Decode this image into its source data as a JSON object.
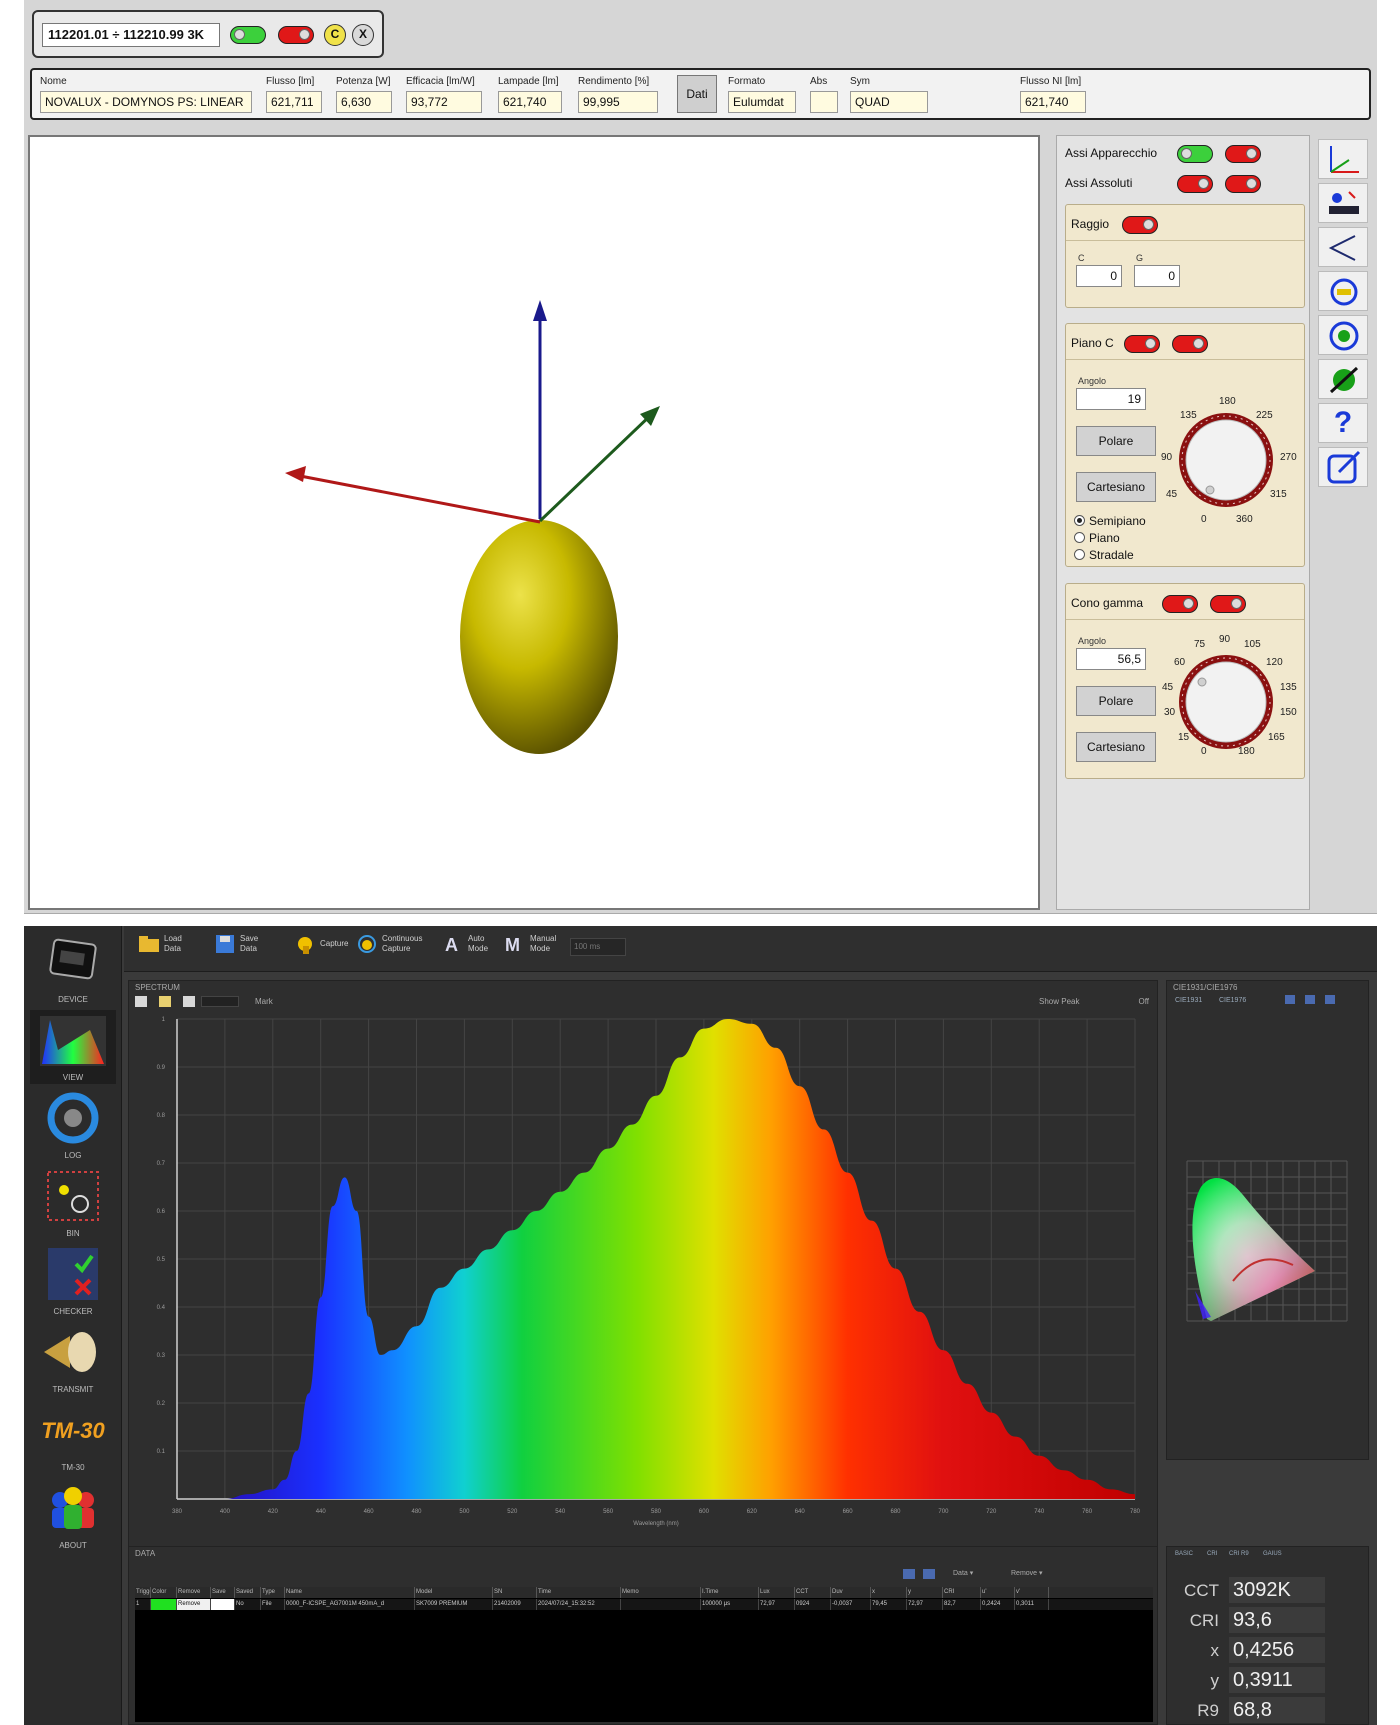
{
  "top_app": {
    "tag_title": "112201.01 ÷ 112210.99 3K",
    "close_btn": "X",
    "c_btn": "C",
    "info_fields": [
      {
        "label": "Nome",
        "value": "NOVALUX - DOMYNOS PS: LINEAR"
      },
      {
        "label": "Flusso [lm]",
        "value": "621,711"
      },
      {
        "label": "Potenza [W]",
        "value": "6,630"
      },
      {
        "label": "Efficacia [lm/W]",
        "value": "93,772"
      },
      {
        "label": "Lampade [lm]",
        "value": "621,740"
      },
      {
        "label": "Rendimento [%]",
        "value": "99,995"
      },
      {
        "label": "Formato",
        "value": "Eulumdat"
      },
      {
        "label": "Abs",
        "value": ""
      },
      {
        "label": "Sym",
        "value": "QUAD"
      },
      {
        "label": "Flusso NI [lm]",
        "value": "621,740"
      }
    ],
    "dati_btn": "Dati",
    "side_panel": {
      "assi_apparecchio": "Assi Apparecchio",
      "assi_assoluti": "Assi Assoluti",
      "raggio": {
        "title": "Raggio",
        "c_label": "C",
        "g_label": "G",
        "c_value": "0",
        "g_value": "0"
      },
      "piano_c": {
        "title": "Piano C",
        "angolo_label": "Angolo",
        "angolo_value": "19",
        "polare": "Polare",
        "cartesiano": "Cartesiano",
        "radios": [
          "Semipiano",
          "Piano",
          "Stradale"
        ],
        "dial_labels": [
          "180",
          "135",
          "225",
          "90",
          "270",
          "45",
          "315",
          "0",
          "360"
        ]
      },
      "cono_gamma": {
        "title": "Cono gamma",
        "angolo_label": "Angolo",
        "angolo_value": "56,5",
        "polare": "Polare",
        "cartesiano": "Cartesiano",
        "dial_labels": [
          "90",
          "75",
          "105",
          "60",
          "120",
          "45",
          "135",
          "30",
          "150",
          "15",
          "165",
          "0",
          "180"
        ]
      },
      "question": "?"
    }
  },
  "bottom_app": {
    "nav": [
      "DEVICE",
      "VIEW",
      "LOG",
      "BIN",
      "CHECKER",
      "TRANSMIT",
      "TM-30",
      "ABOUT"
    ],
    "tm30_logo": "TM-30",
    "toolbar": [
      {
        "name": "load-data",
        "l1": "Load",
        "l2": "Data"
      },
      {
        "name": "save-data",
        "l1": "Save",
        "l2": "Data"
      },
      {
        "name": "capture",
        "l1": "Capture",
        "l2": ""
      },
      {
        "name": "continuous-capture",
        "l1": "Continuous",
        "l2": "Capture"
      },
      {
        "name": "auto-mode",
        "l1": "Auto",
        "l2": "Mode"
      },
      {
        "name": "manual-mode",
        "l1": "Manual",
        "l2": "Mode"
      }
    ],
    "manual_field": "100 ms",
    "spectrum_title": "SPECTRUM",
    "spectrum_tools": {
      "mark": "Mark",
      "show_peak": "Show Peak",
      "off": "Off"
    },
    "cie_title": "CIE1931/CIE1976",
    "cie_tabs": [
      "CIE1931",
      "CIE1976"
    ],
    "data_title": "DATA",
    "data_buttons": {
      "data": "Data ▾",
      "remove": "Remove ▾"
    },
    "table": {
      "columns": [
        "Trigger",
        "Color",
        "Remove",
        "Save",
        "Saved",
        "Type",
        "Name",
        "Model",
        "SN",
        "Time",
        "Memo",
        "I.Time",
        "Lux",
        "CCT",
        "Duv",
        "x",
        "y",
        "CRI",
        "u'",
        "v'"
      ],
      "row": [
        "1",
        "",
        "Remove",
        "",
        "No",
        "File",
        "0000_F-ICSPE_AG7001M 450mA_d",
        "SK7009 PREMIUM",
        "21402009",
        "2024/07/24_15:32:52",
        "",
        "100000 μs",
        "72,97",
        "0924",
        "-0,0037",
        "79,45",
        "72,97",
        "82,7",
        "0,2424",
        "0,3011"
      ]
    },
    "metrics_tabs": [
      "BASIC",
      "CRI",
      "CRI R9",
      "GAIUS"
    ],
    "metrics": [
      {
        "label": "CCT",
        "value": "3092K"
      },
      {
        "label": "CRI",
        "value": "93,6"
      },
      {
        "label": "x",
        "value": "0,4256"
      },
      {
        "label": "y",
        "value": "0,3911"
      },
      {
        "label": "R9",
        "value": "68,8"
      }
    ]
  },
  "chart_data": {
    "type": "area",
    "title": "",
    "xlabel": "Wavelength (nm)",
    "ylabel": "",
    "xlim": [
      380,
      780
    ],
    "ylim": [
      0,
      1
    ],
    "x_ticks": [
      380,
      400,
      420,
      440,
      460,
      480,
      500,
      520,
      540,
      560,
      580,
      600,
      620,
      640,
      660,
      680,
      700,
      720,
      740,
      760,
      780
    ],
    "y_ticks": [
      0.1,
      0.2,
      0.3,
      0.4,
      0.5,
      0.6,
      0.7,
      0.8,
      0.9,
      1
    ],
    "grid": true,
    "series": [
      {
        "x": [
          380,
          390,
          400,
          410,
          420,
          425,
          430,
          435,
          440,
          445,
          450,
          455,
          460,
          465,
          470,
          480,
          490,
          500,
          510,
          520,
          530,
          540,
          550,
          560,
          570,
          580,
          590,
          600,
          610,
          620,
          630,
          640,
          650,
          660,
          670,
          680,
          690,
          700,
          710,
          720,
          730,
          740,
          750,
          760,
          770,
          780
        ],
        "y": [
          0.0,
          0.0,
          0.0,
          0.01,
          0.02,
          0.04,
          0.1,
          0.22,
          0.42,
          0.61,
          0.67,
          0.6,
          0.38,
          0.3,
          0.31,
          0.36,
          0.44,
          0.48,
          0.52,
          0.56,
          0.6,
          0.64,
          0.68,
          0.73,
          0.78,
          0.84,
          0.92,
          0.98,
          1.0,
          0.99,
          0.94,
          0.86,
          0.77,
          0.68,
          0.58,
          0.48,
          0.39,
          0.31,
          0.24,
          0.18,
          0.13,
          0.09,
          0.06,
          0.04,
          0.02,
          0.01
        ]
      }
    ]
  },
  "colors": {
    "toggle_on": "#3cd03c",
    "toggle_off": "#e01818",
    "panel_beige": "#f1e8ce",
    "arrow_blue": "#1a1a8c",
    "arrow_red": "#b01818",
    "arrow_green": "#1d5a1d",
    "solid": "#d4c400"
  }
}
